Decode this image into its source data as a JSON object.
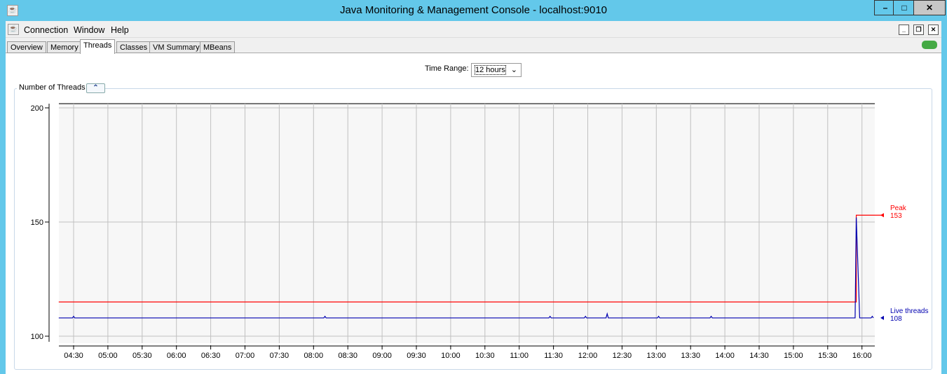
{
  "window": {
    "title": "Java Monitoring & Management Console - localhost:9010",
    "controls": [
      "minimize",
      "maximize",
      "close"
    ]
  },
  "menu": {
    "items": [
      "Connection",
      "Window",
      "Help"
    ]
  },
  "tabs": [
    {
      "label": "Overview"
    },
    {
      "label": "Memory"
    },
    {
      "label": "Threads",
      "active": true
    },
    {
      "label": "Classes"
    },
    {
      "label": "VM Summary"
    },
    {
      "label": "MBeans"
    }
  ],
  "time_range": {
    "label": "Time Range:",
    "value": "12 hours"
  },
  "panel": {
    "title": "Number of Threads"
  },
  "chart_data": {
    "type": "line",
    "title": "Number of Threads",
    "ylim": [
      100,
      200
    ],
    "yticks": [
      100,
      150,
      200
    ],
    "xlim": [
      "04:17",
      "16:18"
    ],
    "xticks": [
      "04:30",
      "05:00",
      "05:30",
      "06:00",
      "06:30",
      "07:00",
      "07:30",
      "08:00",
      "08:30",
      "09:00",
      "09:30",
      "10:00",
      "10:30",
      "11:00",
      "11:30",
      "12:00",
      "12:30",
      "13:00",
      "13:30",
      "14:00",
      "14:30",
      "15:00",
      "15:30",
      "16:00"
    ],
    "grid": true,
    "legend": "right",
    "colors": {
      "peak": "#ff0000",
      "live": "#0000b0"
    },
    "series": [
      {
        "name": "Peak",
        "label_value": "153",
        "points": [
          [
            "04:17",
            115
          ],
          [
            "15:54",
            115
          ],
          [
            "15:55",
            153
          ],
          [
            "16:18",
            153
          ]
        ]
      },
      {
        "name": "Live threads",
        "label_value": "108",
        "points": [
          [
            "04:17",
            108
          ],
          [
            "04:29",
            108
          ],
          [
            "04:30",
            108.7
          ],
          [
            "04:31",
            108
          ],
          [
            "08:09",
            108
          ],
          [
            "08:10",
            108.7
          ],
          [
            "08:11",
            108
          ],
          [
            "11:26",
            108
          ],
          [
            "11:27",
            108.7
          ],
          [
            "11:28",
            108
          ],
          [
            "11:57",
            108
          ],
          [
            "11:58",
            108.7
          ],
          [
            "11:59",
            108
          ],
          [
            "12:16",
            108
          ],
          [
            "12:17",
            109.8
          ],
          [
            "12:18",
            108
          ],
          [
            "13:01",
            108
          ],
          [
            "13:02",
            108.7
          ],
          [
            "13:03",
            108
          ],
          [
            "13:47",
            108
          ],
          [
            "13:48",
            108.7
          ],
          [
            "13:49",
            108
          ],
          [
            "15:54",
            108
          ],
          [
            "15:55",
            152
          ],
          [
            "15:58",
            108
          ],
          [
            "16:08",
            108
          ],
          [
            "16:09",
            108.7
          ],
          [
            "16:10",
            108
          ]
        ]
      }
    ]
  }
}
